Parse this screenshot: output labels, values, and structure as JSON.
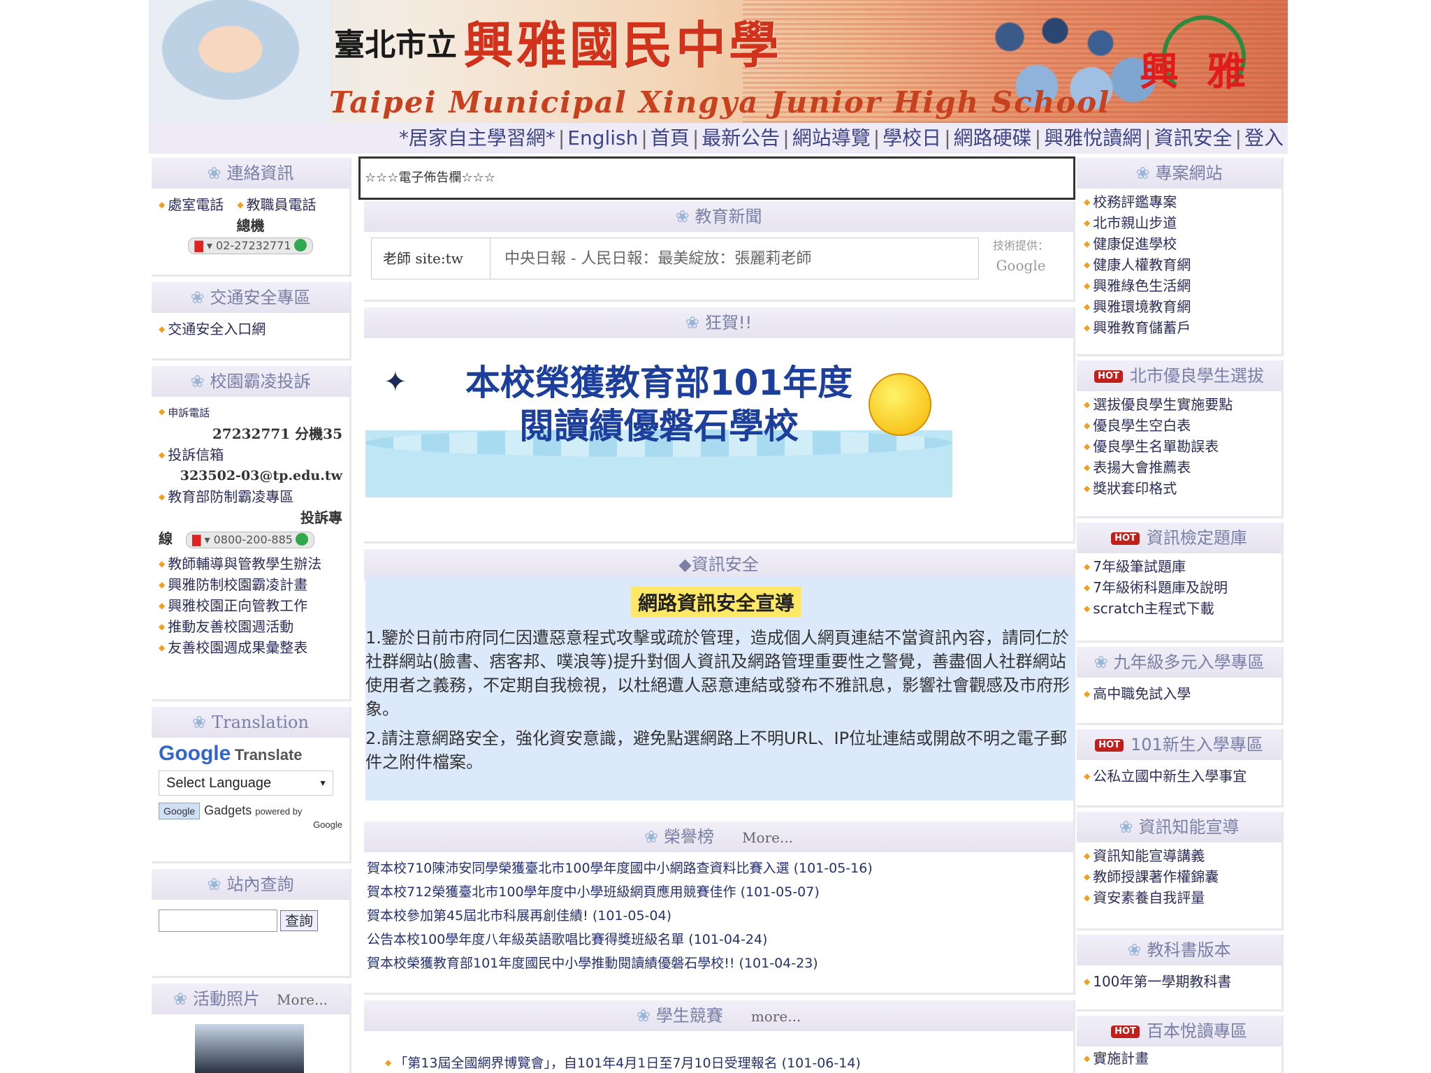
{
  "banner": {
    "prefix": "臺北市立",
    "title": "興雅國民中學",
    "english": "Taipei Municipal Xingya Junior High School",
    "logo_text": "興雅"
  },
  "nav": [
    "*居家自主學習網*",
    "English",
    "首頁",
    "最新公告",
    "網站導覽",
    "學校日",
    "網路硬碟",
    "興雅悅讀網",
    "資訊安全",
    "登入"
  ],
  "left": {
    "contact": {
      "title": "連絡資訊",
      "items": [
        "處室電話",
        "教職員電話"
      ],
      "hotline_label": "總機",
      "phone": "02-27232771"
    },
    "traffic": {
      "title": "交通安全專區",
      "items": [
        "交通安全入口網"
      ]
    },
    "bullying": {
      "title": "校園霸凌投訴",
      "complaint_phone_label": "申訴電話",
      "complaint_phone": "27232771 分機35",
      "mailbox_label": "投訴信箱",
      "mailbox": "323502-03@tp.edu.tw",
      "moe_label": "教育部防制霸凌專區",
      "hotline_tail": "投訴專",
      "hotline_head": "線",
      "hotline_phone": "0800-200-885",
      "items": [
        "教師輔導與管教學生辦法",
        "興雅防制校園霸凌計畫",
        "興雅校園正向管教工作",
        "推動友善校園週活動",
        "友善校園週成果彙整表"
      ]
    },
    "translation": {
      "title": "Translation",
      "google": "Google",
      "translate": "Translate",
      "select": "Select Language",
      "gadgets_btn": "Google",
      "gadgets": "Gadgets",
      "powered": "powered by",
      "powered2": "Google"
    },
    "search": {
      "title": "站內查詢",
      "button": "查詢"
    },
    "photos": {
      "title": "活動照片",
      "more": "More..."
    }
  },
  "center": {
    "marquee": "☆☆☆電子佈告欄☆☆☆",
    "edu_news": {
      "title": "教育新聞",
      "label": "老師 site:tw",
      "headline": "中央日報 - 人民日報：最美綻放：張麗莉老師",
      "powered1": "技術提供：",
      "powered2": "Google"
    },
    "congrats": {
      "title": "狂賀!!",
      "line1": "本校榮獲教育部101年度",
      "line2": "閱讀績優磐石學校"
    },
    "security": {
      "title": "◆資訊安全",
      "heading": "網路資訊安全宣導",
      "p1": "1.鑒於日前市府同仁因遭惡意程式攻擊或疏於管理，造成個人網頁連結不當資訊內容，請同仁於社群網站(臉書、痞客邦、噗浪等)提升對個人資訊及網路管理重要性之警覺，善盡個人社群網站使用者之義務，不定期自我檢視，以杜絕遭人惡意連結或發布不雅訊息，影響社會觀感及市府形象。",
      "p2": "2.請注意網路安全，強化資安意識，避免點選網路上不明URL、IP位址連結或開啟不明之電子郵件之附件檔案。"
    },
    "honors": {
      "title": "榮譽榜",
      "more": "More...",
      "items": [
        "賀本校710陳沛安同學榮獲臺北市100學年度國中小網路查資料比賽入選 (101-05-16)",
        "賀本校712榮獲臺北市100學年度中小學班級網頁應用競賽佳作 (101-05-07)",
        "賀本校參加第45屆北市科展再創佳績! (101-05-04)",
        "公告本校100學年度八年級英語歌唱比賽得獎班級名單 (101-04-24)",
        "賀本校榮獲教育部101年度國民中小學推動閱讀績優磐石學校!! (101-04-23)"
      ]
    },
    "competition": {
      "title": "學生競賽",
      "more": "more...",
      "first": "「第13屆全國網界博覽會」，自101年4月1日至7月10日受理報名 (101-06-14)"
    }
  },
  "right": {
    "projects": {
      "title": "專案網站",
      "items": [
        "校務評鑑專案",
        "北市親山步道",
        "健康促進學校",
        "健康人權教育網",
        "興雅綠色生活網",
        "興雅環境教育網",
        "興雅教育儲蓄戶"
      ]
    },
    "excellent": {
      "title": "北市優良學生選拔",
      "items": [
        "選拔優良學生實施要點",
        "優良學生空白表",
        "優良學生名單勘誤表",
        "表揚大會推薦表",
        "獎狀套印格式"
      ]
    },
    "it_test": {
      "title": "資訊檢定題庫",
      "items": [
        "7年級筆試題庫",
        "7年級術科題庫及說明",
        "scratch主程式下載"
      ]
    },
    "grade9": {
      "title": "九年級多元入學專區",
      "items": [
        "高中職免試入學"
      ]
    },
    "new101": {
      "title": "101新生入學專區",
      "items": [
        "公私立國中新生入學事宜"
      ]
    },
    "literacy": {
      "title": "資訊知能宣導",
      "items": [
        "資訊知能宣導講義",
        "教師授課著作權錦囊",
        "資安素養自我評量"
      ]
    },
    "textbook": {
      "title": "教科書版本",
      "items": [
        "100年第一學期教科書"
      ]
    },
    "reading": {
      "title": "百本悅讀專區",
      "items": [
        "實施計畫"
      ]
    }
  }
}
